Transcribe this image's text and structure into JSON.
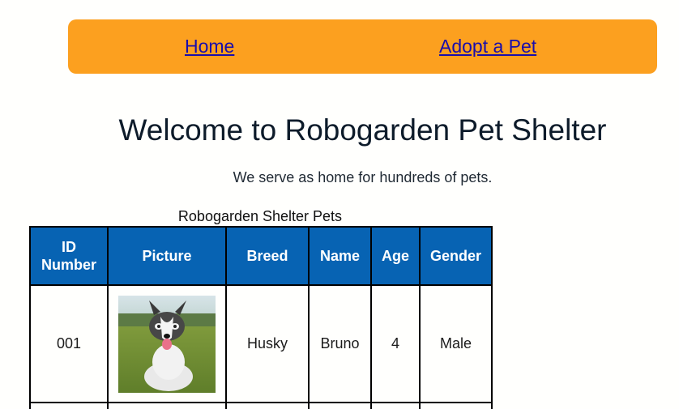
{
  "nav": {
    "home_label": "Home",
    "adopt_label": "Adopt a Pet",
    "background": "#fca01f"
  },
  "main": {
    "title": "Welcome to Robogarden Pet Shelter",
    "subtitle": "We serve as home for hundreds of pets."
  },
  "table": {
    "caption": "Robogarden Shelter Pets",
    "header_color": "#0763b3",
    "headers": {
      "id_line1": "ID",
      "id_line2": "Number",
      "picture": "Picture",
      "breed": "Breed",
      "name": "Name",
      "age": "Age",
      "gender": "Gender"
    },
    "rows": [
      {
        "id": "001",
        "picture_icon": "husky-dog-photo",
        "breed": "Husky",
        "name": "Bruno",
        "age": "4",
        "gender": "Male"
      }
    ]
  }
}
